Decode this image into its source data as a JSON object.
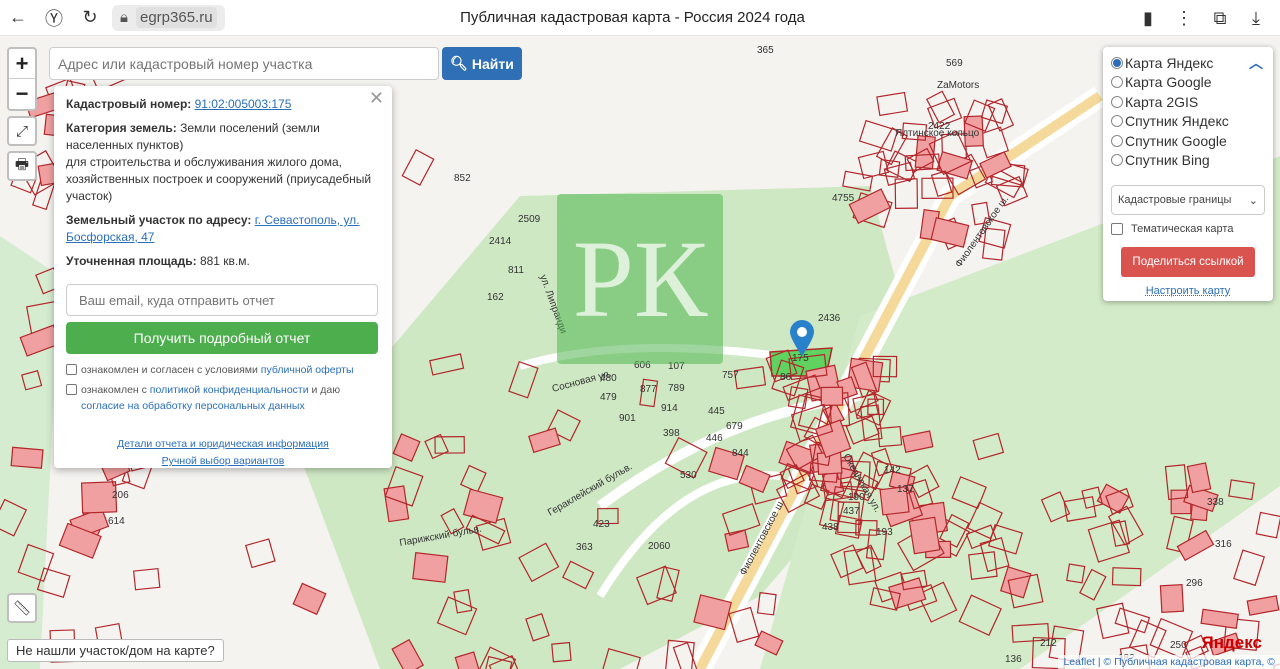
{
  "browser": {
    "url": "egrp365.ru",
    "title": "Публичная кадастровая карта - Россия 2024 года"
  },
  "search": {
    "placeholder": "Адрес или кадастровый номер участка",
    "button": "Найти"
  },
  "zoom": {
    "in": "+",
    "out": "−"
  },
  "popup": {
    "cad_label": "Кадастровый номер:",
    "cad_value": "91:02:005003:175",
    "cat_label": "Категория земель:",
    "cat_value": "Земли поселений (земли населенных пунктов)",
    "use": "для строительства и обслуживания жилого дома, хозяйственных построек и сооружений (приусадебный участок)",
    "addr_label": "Земельный участок по адресу:",
    "addr_value": "г. Севастополь, ул. Босфорская, 47",
    "area_label": "Уточненная площадь:",
    "area_value": "881 кв.м.",
    "email_placeholder": "Ваш email, куда отправить отчет",
    "report_button": "Получить подробный отчет",
    "chk1_text": "ознакомлен и согласен с условиями ",
    "chk1_link": "публичной оферты",
    "chk2_text1": "ознакомлен с ",
    "chk2_link1": "политикой конфиденциальности",
    "chk2_text2": " и даю ",
    "chk2_link2": "согласие на обработку персональных данных",
    "details_link": "Детали отчета и юридическая информация",
    "manual_link": "Ручной выбор вариантов"
  },
  "layers": {
    "options": [
      "Карта Яндекс",
      "Карта Google",
      "Карта 2GIS",
      "Спутник Яндекс",
      "Спутник Google",
      "Спутник Bing"
    ],
    "selected": "Карта Яндекс",
    "select_value": "Кадастровые границы",
    "thematic": "Тематическая карта",
    "share": "Поделиться ссылкой",
    "setup": "Настроить карту"
  },
  "map": {
    "streets": [
      "Фиолентовское ш.",
      "Фиолентовское ш.",
      "ул. Липранди",
      "Сосновая ул.",
      "Гераклейский бульв.",
      "Парижский бульв.",
      "Океанская ул.",
      "ZaMotors",
      "Ялтинское кольцо"
    ],
    "parcels": [
      "365",
      "569",
      "4755",
      "2436",
      "175",
      "86",
      "757",
      "445",
      "446",
      "844",
      "679",
      "107",
      "789",
      "877",
      "606",
      "480",
      "479",
      "901",
      "914",
      "398",
      "530",
      "2060",
      "363",
      "423",
      "137",
      "142",
      "193",
      "438",
      "437",
      "190",
      "614",
      "206",
      "338",
      "316",
      "296",
      "2422",
      "2509",
      "2414",
      "811",
      "162",
      "852",
      "136",
      "212",
      "182",
      "250"
    ],
    "not_found": "Не нашли участок/дом на карте?",
    "attribution": "Leaflet | © Публичная кадастровая карта, ©",
    "provider_logo": "Яндекс",
    "watermark": "РК"
  },
  "colors": {
    "accent": "#2f6fb5",
    "green": "#4cae4c",
    "red": "#d9534f",
    "parcel": "#b3262b"
  }
}
